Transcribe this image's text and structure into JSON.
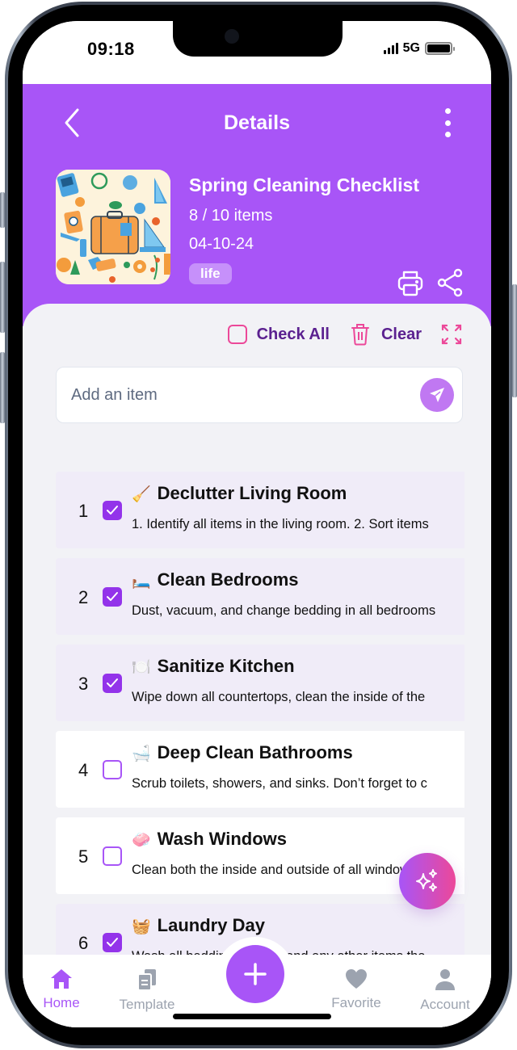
{
  "status_bar": {
    "time": "09:18",
    "network": "5G",
    "battery_level": 1.0
  },
  "header": {
    "title": "Details",
    "back_icon": "chevron-left-icon",
    "more_icon": "more-vertical-icon"
  },
  "checklist": {
    "title": "Spring Cleaning Checklist",
    "count_text": "8  / 10 items",
    "completed": 8,
    "total": 10,
    "date": "04-10-24",
    "tag": "life",
    "cover_image": "travel-pattern-illustration"
  },
  "actions": {
    "print_icon": "printer-icon",
    "share_icon": "share-icon"
  },
  "toolbar": {
    "check_all_label": "Check All",
    "clear_label": "Clear",
    "expand_icon": "expand-icon"
  },
  "add_item": {
    "placeholder": "Add an item",
    "value": ""
  },
  "items": [
    {
      "number": "1",
      "emoji": "🧹",
      "title": "Declutter Living Room",
      "description": "1. Identify all items in the living room. 2. Sort items",
      "checked": true
    },
    {
      "number": "2",
      "emoji": "🛏️",
      "title": "Clean Bedrooms",
      "description": "Dust, vacuum, and change bedding in all bedrooms",
      "checked": true
    },
    {
      "number": "3",
      "emoji": "🍽️",
      "title": "Sanitize Kitchen",
      "description": "Wipe down all countertops, clean the inside of the",
      "checked": true
    },
    {
      "number": "4",
      "emoji": "🛁",
      "title": "Deep Clean Bathrooms",
      "description": "Scrub toilets, showers, and sinks. Don’t forget to c",
      "checked": false
    },
    {
      "number": "5",
      "emoji": "🧼",
      "title": "Wash Windows",
      "description": "Clean both the inside and outside of all windows.",
      "checked": false
    },
    {
      "number": "6",
      "emoji": "🧺",
      "title": "Laundry Day",
      "description": "Wash all bedding, towels, and any other items tha",
      "checked": true
    }
  ],
  "tabbar": {
    "tabs": [
      {
        "label": "Home",
        "icon": "home-icon",
        "active": true
      },
      {
        "label": "Template",
        "icon": "template-icon",
        "active": false
      },
      {
        "label": "Favorite",
        "icon": "heart-icon",
        "active": false
      },
      {
        "label": "Account",
        "icon": "user-icon",
        "active": false
      }
    ],
    "add_icon": "plus-icon"
  },
  "colors": {
    "primary": "#a855f7",
    "checked": "#9333ea",
    "accent_pink": "#ec4899",
    "toolbar_text": "#5b2190",
    "inactive": "#9ca3af"
  }
}
